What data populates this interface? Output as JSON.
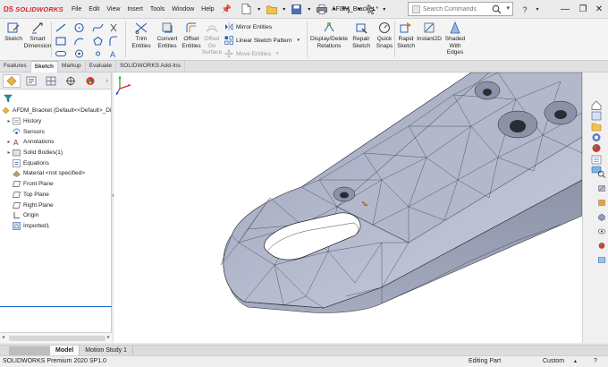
{
  "app": {
    "logo_mark": "DS",
    "logo_text": "SOLIDWORKS",
    "document_title": "AFDM_Bracket *"
  },
  "menu": [
    "File",
    "Edit",
    "View",
    "Insert",
    "Tools",
    "Window",
    "Help"
  ],
  "search": {
    "placeholder": "Search Commands"
  },
  "ribbon": {
    "sketch": "Sketch",
    "smart_dimension_1": "Smart",
    "smart_dimension_2": "Dimension",
    "trim_1": "Trim",
    "trim_2": "Entities",
    "convert_1": "Convert",
    "convert_2": "Entities",
    "offset_1": "Offset",
    "offset_2": "Entities",
    "offset_surface_1": "Offset",
    "offset_surface_2": "On",
    "offset_surface_3": "Surface",
    "mirror": "Mirror Entities",
    "linear_pattern": "Linear Sketch Pattern",
    "move": "Move Entities",
    "display_delete_1": "Display/Delete",
    "display_delete_2": "Relations",
    "repair_1": "Repair",
    "repair_2": "Sketch",
    "quick_snaps_1": "Quick",
    "quick_snaps_2": "Snaps",
    "rapid_1": "Rapid",
    "rapid_2": "Sketch",
    "instant2d": "Instant2D",
    "shaded_1": "Shaded",
    "shaded_2": "With",
    "shaded_3": "Edges"
  },
  "command_tabs": [
    "Features",
    "Sketch",
    "Markup",
    "Evaluate",
    "SOLIDWORKS Add-Ins"
  ],
  "command_tab_active": "Sketch",
  "tree": {
    "root": "AFDM_Bracket  (Default<<Default>_Di",
    "items": [
      {
        "label": "History",
        "expandable": true
      },
      {
        "label": "Sensors",
        "expandable": false
      },
      {
        "label": "Annotations",
        "expandable": true
      },
      {
        "label": "Solid Bodies(1)",
        "expandable": true
      },
      {
        "label": "Equations",
        "expandable": false
      },
      {
        "label": "Material <not specified>",
        "expandable": false
      },
      {
        "label": "Front Plane",
        "expandable": false
      },
      {
        "label": "Top Plane",
        "expandable": false
      },
      {
        "label": "Right Plane",
        "expandable": false
      },
      {
        "label": "Origin",
        "expandable": false
      },
      {
        "label": "Imported1",
        "expandable": false
      }
    ]
  },
  "bottom_tabs": [
    "Model",
    "Motion Study 1"
  ],
  "status": {
    "version": "SOLIDWORKS Premium 2020 SP1.0",
    "mode": "Editing Part",
    "units": "Custom"
  },
  "colors": {
    "brand_red": "#d8232a",
    "selection_blue": "#1a6fc9",
    "mesh_fill": "#aab0c3"
  },
  "icons": {
    "triad": "xyz-triad-icon",
    "filter": "funnel-icon"
  }
}
